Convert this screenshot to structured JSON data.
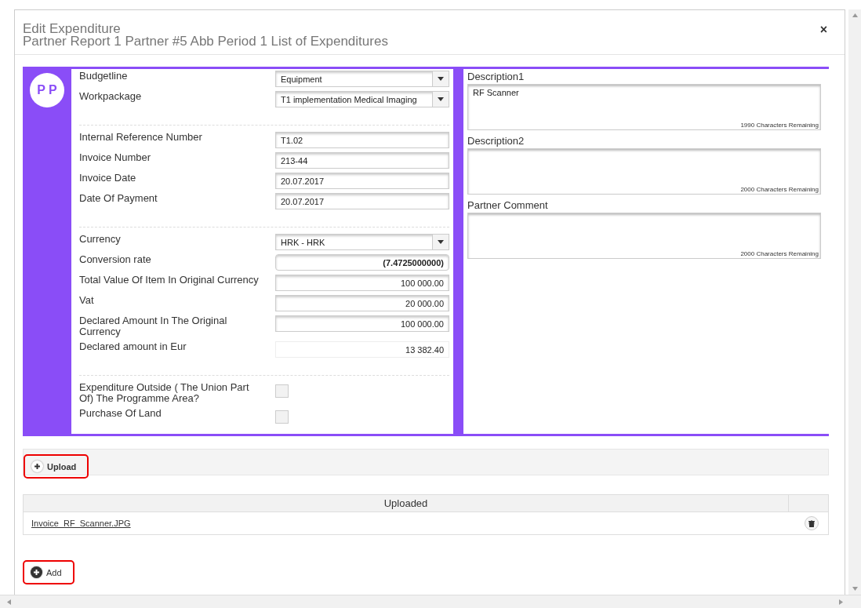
{
  "dialog": {
    "title": "Edit Expenditure",
    "subtitle": "Partner Report 1 Partner #5 Abb Period 1 List of Expenditures",
    "close": "×"
  },
  "avatar": "P P",
  "groups": [
    [
      {
        "label": "Budgetline",
        "kind": "select",
        "value": "Equipment"
      },
      {
        "label": "Workpackage",
        "kind": "select",
        "value": "T1 implementation Medical Imaging"
      }
    ],
    [
      {
        "label": "Internal Reference Number",
        "kind": "text",
        "value": "T1.02"
      },
      {
        "label": "Invoice Number",
        "kind": "text",
        "value": "213-44"
      },
      {
        "label": "Invoice Date",
        "kind": "text",
        "value": "20.07.2017"
      },
      {
        "label": "Date Of Payment",
        "kind": "text",
        "value": "20.07.2017"
      }
    ],
    [
      {
        "label": "Currency",
        "kind": "select",
        "value": "HRK - HRK"
      },
      {
        "label": "Conversion rate",
        "kind": "rate",
        "value": "(7.4725000000)"
      },
      {
        "label": "Total Value Of Item In Original Currency",
        "kind": "number",
        "value": "100 000.00"
      },
      {
        "label": "Vat",
        "kind": "number",
        "value": "20 000.00"
      },
      {
        "label": "Declared Amount In The Original Currency",
        "kind": "number",
        "value": "100 000.00"
      },
      {
        "label": "Declared amount in Eur",
        "kind": "readonly",
        "value": "13 382.40"
      }
    ],
    [
      {
        "label": "Expenditure Outside ( The Union Part Of) The Programme Area?",
        "kind": "checkbox",
        "checked": false
      },
      {
        "label": "Purchase Of Land",
        "kind": "checkbox",
        "checked": false
      }
    ]
  ],
  "text_areas": [
    {
      "label": "Description1",
      "value": "RF Scanner",
      "remaining": "1990 Characters Remaining"
    },
    {
      "label": "Description2",
      "remaining": "2000 Characters Remaining"
    },
    {
      "label": "Partner Comment",
      "remaining": "2000 Characters Remaining"
    }
  ],
  "upload_button": "Upload",
  "uploads": {
    "column": "Uploaded",
    "rows": [
      {
        "file": "Invoice_RF_Scanner.JPG"
      }
    ]
  },
  "add_button": "Add"
}
